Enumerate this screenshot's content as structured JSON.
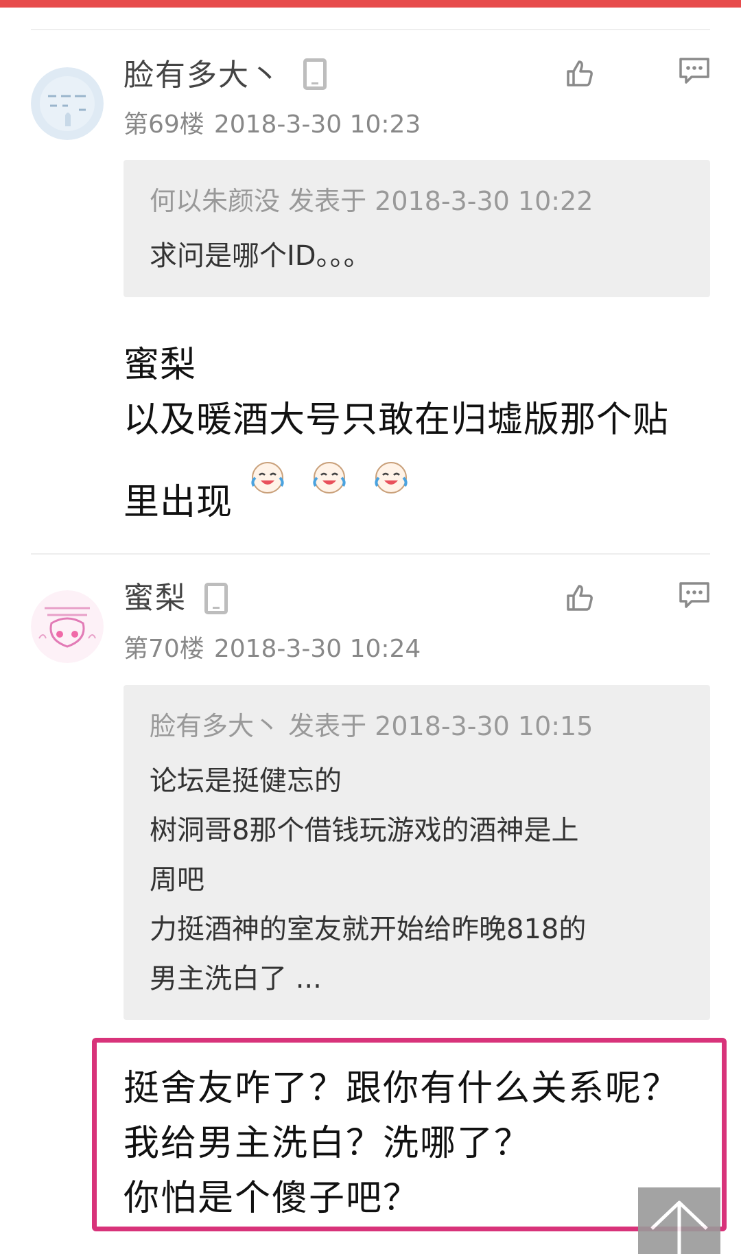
{
  "posts": [
    {
      "username": "脸有多大丶",
      "floor": "第69楼",
      "timestamp": "2018-3-30 10:23",
      "quote": {
        "meta": "何以朱颜没 发表于 2018-3-30 10:22",
        "lines": [
          "求问是哪个ID。。。"
        ]
      },
      "body_lines": [
        "蜜梨",
        "以及暖酒大号只敢在归墟版那个贴",
        "里出现"
      ]
    },
    {
      "username": "蜜梨",
      "floor": "第70楼",
      "timestamp": "2018-3-30 10:24",
      "quote": {
        "meta": "脸有多大丶 发表于 2018-3-30 10:15",
        "lines": [
          "论坛是挺健忘的",
          "树洞哥8那个借钱玩游戏的酒神是上",
          "周吧",
          "力挺酒神的室友就开始给昨晚818的",
          "男主洗白了 ..."
        ]
      },
      "body_lines": [
        "挺舍友咋了？跟你有什么关系呢？",
        "我给男主洗白？洗哪了？",
        "你怕是个傻子吧？"
      ]
    }
  ],
  "icons": {
    "like": "thumbs-up-icon",
    "comment": "comment-icon",
    "device": "mobile-device-icon",
    "emoji": "crying-laughing-emoji",
    "back_to_top": "arrow-up-icon"
  },
  "colors": {
    "top_bar": "#e74c4c",
    "highlight_border": "#d8337a",
    "quote_bg": "#eeeeee"
  }
}
